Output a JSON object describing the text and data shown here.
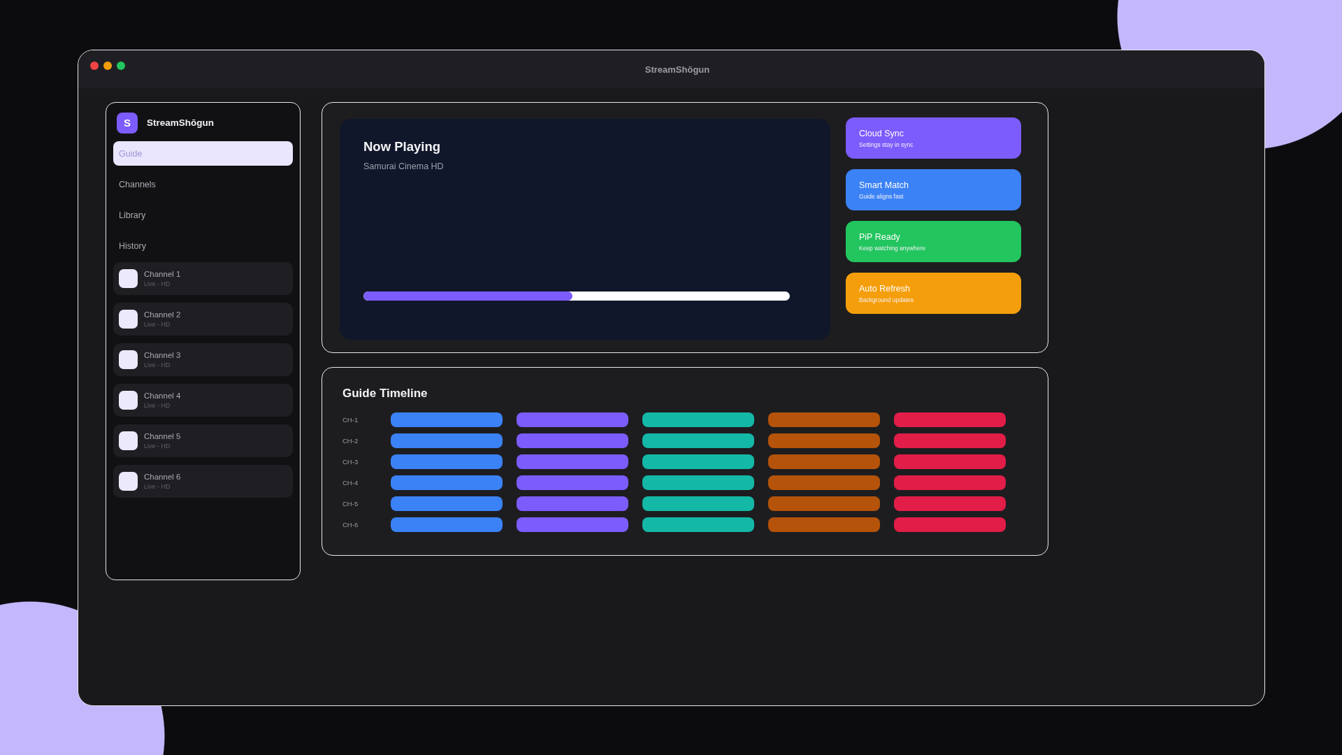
{
  "window": {
    "title": "StreamShōgun"
  },
  "sidebar": {
    "brand": {
      "logo": "S",
      "name": "StreamShōgun"
    },
    "nav": [
      {
        "label": "Guide",
        "selected": true
      },
      {
        "label": "Channels",
        "selected": false
      },
      {
        "label": "Library",
        "selected": false
      },
      {
        "label": "History",
        "selected": false
      }
    ],
    "channels": [
      {
        "name": "Channel 1",
        "status": "Live - HD"
      },
      {
        "name": "Channel 2",
        "status": "Live - HD"
      },
      {
        "name": "Channel 3",
        "status": "Live - HD"
      },
      {
        "name": "Channel 4",
        "status": "Live - HD"
      },
      {
        "name": "Channel 5",
        "status": "Live - HD"
      },
      {
        "name": "Channel 6",
        "status": "Live - HD"
      }
    ]
  },
  "now_playing": {
    "title": "Now Playing",
    "subtitle": "Samurai Cinema HD",
    "progress": {
      "level": 0.49
    }
  },
  "features": [
    {
      "title": "Cloud Sync",
      "description": "Settings stay in sync",
      "color": "#7c5cfc"
    },
    {
      "title": "Smart Match",
      "description": "Guide aligns fast",
      "color": "#3b82f6"
    },
    {
      "title": "PiP Ready",
      "description": "Keep watching anywhere",
      "color": "#22c55e"
    },
    {
      "title": "Auto Refresh",
      "description": "Background updates",
      "color": "#f59e0b"
    }
  ],
  "guide": {
    "title": "Guide Timeline",
    "channels": [
      {
        "label": "CH-1"
      },
      {
        "label": "CH-2"
      },
      {
        "label": "CH-3"
      },
      {
        "label": "CH-4"
      },
      {
        "label": "CH-5"
      },
      {
        "label": "CH-6"
      }
    ],
    "slots": [
      {
        "color": "#3b82f6"
      },
      {
        "color": "#7c5cfc"
      },
      {
        "color": "#14b8a6"
      },
      {
        "color": "#b45309"
      },
      {
        "color": "#e11d48"
      }
    ]
  }
}
